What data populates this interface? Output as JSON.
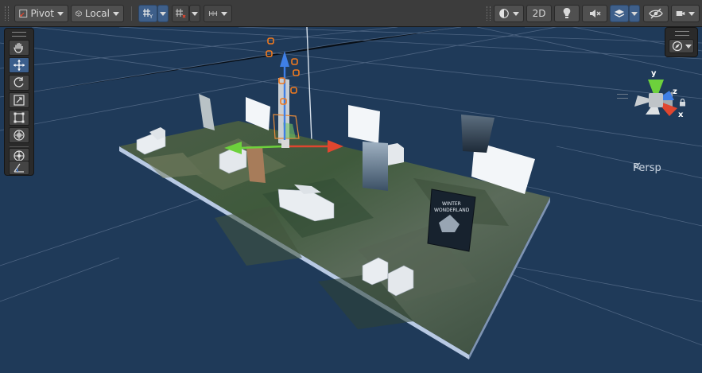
{
  "toolbar": {
    "pivot_label": "Pivot",
    "local_label": "Local",
    "mode_2d_label": "2D"
  },
  "scene": {
    "view_mode_label": "Persp",
    "axis_y": "y",
    "axis_z": "z",
    "axis_x": "x",
    "poster_title_line1": "WINTER",
    "poster_title_line2": "WONDERLAND"
  },
  "colors": {
    "scene_bg": "#1f3a59",
    "toolbar_bg": "#3c3c3c",
    "active_blue": "#3e5f8a",
    "axis_x": "#e0462f",
    "axis_y": "#6dd13c",
    "axis_z": "#3f7fe6"
  },
  "icons": {
    "pivot": "pivot-icon",
    "local": "local-space-icon",
    "grid_snap": "grid-snap-icon",
    "snap_increment": "snap-increment-icon",
    "gizmo_lock": "lock-icon"
  }
}
